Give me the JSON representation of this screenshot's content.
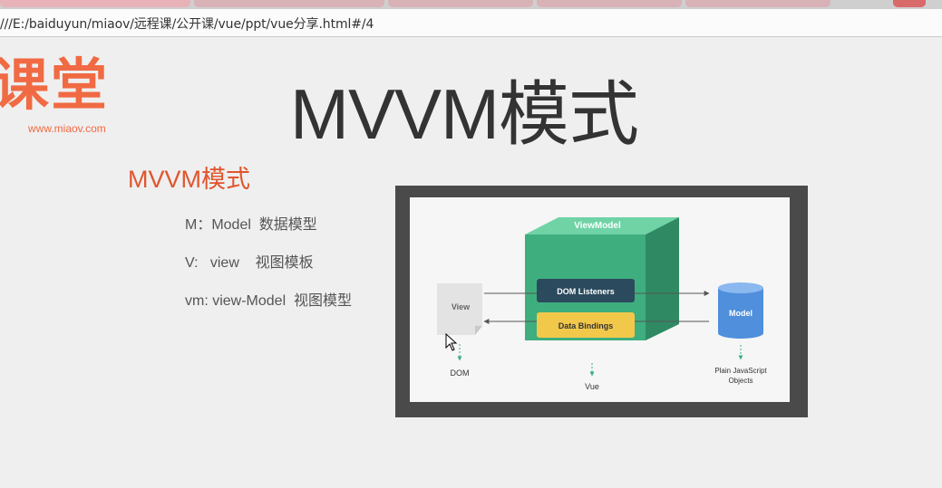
{
  "browser": {
    "url": "///E:/baiduyun/miaov/远程课/公开课/vue/ppt/vue分享.html#/4"
  },
  "logo": {
    "brand_text": "课堂",
    "url_text": "www.miaov.com"
  },
  "slide": {
    "title": "MVVM模式",
    "subtitle": "MVVM模式",
    "items": [
      "M：Model  数据模型",
      "V:   view    视图模板",
      "vm: view-Model  视图模型"
    ]
  },
  "diagram": {
    "viewmodel_label": "ViewModel",
    "dom_listeners_label": "DOM Listeners",
    "data_bindings_label": "Data Bindings",
    "view_label": "View",
    "model_label": "Model",
    "dom_label": "DOM",
    "vue_label": "Vue",
    "plain_js_label_1": "Plain JavaScript",
    "plain_js_label_2": "Objects"
  },
  "colors": {
    "accent": "#f06a43",
    "subtitle": "#e0562e",
    "viewmodel_green": "#3fae7f",
    "listeners_navy": "#2b4a5e",
    "bindings_yellow": "#f2c84b",
    "model_blue": "#4f8fdc"
  }
}
